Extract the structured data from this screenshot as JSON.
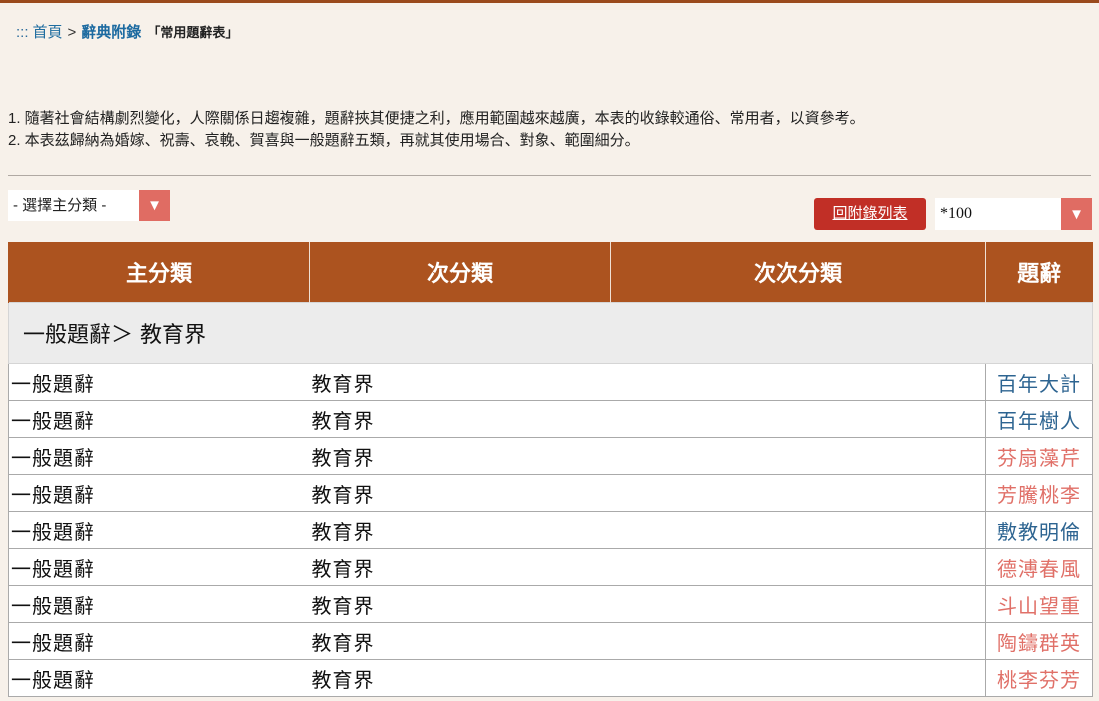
{
  "breadcrumb": {
    "dots": ":::",
    "home": "首頁",
    "sep1": ">",
    "dict": "辭典附錄",
    "current": "「常用題辭表」"
  },
  "notes": [
    "1. 隨著社會結構劇烈變化，人際關係日趨複雜，題辭挾其便捷之利，應用範圍越來越廣，本表的收錄較通俗、常用者，以資參考。",
    "2. 本表茲歸納為婚嫁、祝壽、哀輓、賀喜與一般題辭五類，再就其使用場合、對象、範圍細分。"
  ],
  "controls": {
    "main_category_select": "- 選擇主分類 -",
    "dropdown_icon": "triangle-down-icon",
    "back_button": "回附錄列表",
    "page_size_select": "*100"
  },
  "table": {
    "headers": [
      "主分類",
      "次分類",
      "次次分類",
      "題辭"
    ],
    "group_label": "一般題辭＞ 教育界",
    "rows": [
      {
        "main": "一般題辭",
        "sub": "教育界",
        "subsub": "",
        "tici": "百年大計",
        "color": "#2d6491"
      },
      {
        "main": "一般題辭",
        "sub": "教育界",
        "subsub": "",
        "tici": "百年樹人",
        "color": "#2d6491"
      },
      {
        "main": "一般題辭",
        "sub": "教育界",
        "subsub": "",
        "tici": "芬扇藻芹",
        "color": "#e07068"
      },
      {
        "main": "一般題辭",
        "sub": "教育界",
        "subsub": "",
        "tici": "芳騰桃李",
        "color": "#e07068"
      },
      {
        "main": "一般題辭",
        "sub": "教育界",
        "subsub": "",
        "tici": "敷教明倫",
        "color": "#2d6491"
      },
      {
        "main": "一般題辭",
        "sub": "教育界",
        "subsub": "",
        "tici": "德溥春風",
        "color": "#e07068"
      },
      {
        "main": "一般題辭",
        "sub": "教育界",
        "subsub": "",
        "tici": "斗山望重",
        "color": "#e07068"
      },
      {
        "main": "一般題辭",
        "sub": "教育界",
        "subsub": "",
        "tici": "陶鑄群英",
        "color": "#e07068"
      },
      {
        "main": "一般題辭",
        "sub": "教育界",
        "subsub": "",
        "tici": "桃李芬芳",
        "color": "#e07068"
      }
    ]
  },
  "colors": {
    "header_bg": "#ac531f",
    "button_red": "#c12f26",
    "dropdown_arrow_bg": "#e06c63",
    "link_blue": "#2d6491",
    "link_red": "#e07068"
  }
}
